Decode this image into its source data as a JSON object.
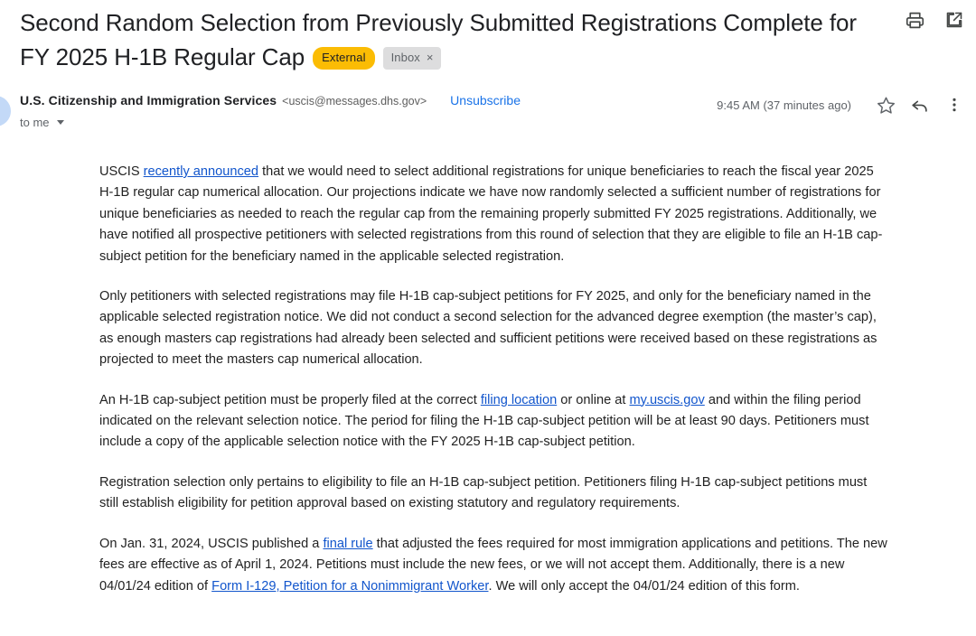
{
  "subject": {
    "text": "Second Random Selection from Previously Submitted Registrations Complete for FY 2025 H-1B Regular Cap",
    "external_badge": "External",
    "inbox_label": "Inbox",
    "inbox_close": "×"
  },
  "header_actions": [
    {
      "name": "print-icon",
      "title": "Print all"
    },
    {
      "name": "open-in-new-window-icon",
      "title": "In new window"
    }
  ],
  "sender": {
    "name": "U.S. Citizenship and Immigration Services",
    "email": "<uscis@messages.dhs.gov>",
    "unsubscribe": "Unsubscribe",
    "recipients": "to me",
    "timestamp": "9:45 AM (37 minutes ago)"
  },
  "message_actions": [
    {
      "name": "star-icon",
      "title": "Not starred"
    },
    {
      "name": "reply-icon",
      "title": "Reply"
    },
    {
      "name": "more-options-icon",
      "title": "More"
    }
  ],
  "body": {
    "p1_a": "USCIS ",
    "p1_link": "recently announced",
    "p1_b": " that we would need to select additional registrations for unique beneficiaries to reach the fiscal year 2025 H-1B regular cap numerical allocation. Our projections indicate we have now randomly selected a sufficient number of registrations for unique beneficiaries as needed to reach the regular cap from the remaining properly submitted FY 2025 registrations. Additionally, we have notified all prospective petitioners with selected registrations from this round of selection that they are eligible to file an H-1B cap-subject petition for the beneficiary named in the applicable selected registration.",
    "p2": "Only petitioners with selected registrations may file H-1B cap-subject petitions for FY 2025, and only for the beneficiary named in the applicable selected registration notice. We did not conduct a second selection for the advanced degree exemption (the master’s cap), as enough masters cap registrations had already been selected and sufficient petitions were received based on these registrations as projected to meet the masters cap numerical allocation.",
    "p3_a": "An H-1B cap-subject petition must be properly filed at the correct ",
    "p3_link1": "filing location",
    "p3_b": " or online at ",
    "p3_link2": "my.uscis.gov",
    "p3_c": " and within the filing period indicated on the relevant selection notice. The period for filing the H-1B cap-subject petition will be at least 90 days. Petitioners must include a copy of the applicable selection notice with the FY 2025 H-1B cap-subject petition.",
    "p4": "Registration selection only pertains to eligibility to file an H-1B cap-subject petition. Petitioners filing H-1B cap-subject petitions must still establish eligibility for petition approval based on existing statutory and regulatory requirements.",
    "p5_a": "On Jan. 31, 2024, USCIS published a ",
    "p5_link1": "final rule",
    "p5_b": " that adjusted the fees required for most immigration applications and petitions. The new fees are effective as of April 1, 2024. Petitions must include the new fees, or we will not accept them. Additionally, there is a new 04/01/24 edition of ",
    "p5_link2": "Form I-129, Petition for a Nonimmigrant Worker",
    "p5_c": ". We will only accept the 04/01/24 edition of this form."
  },
  "colors": {
    "external_badge_bg": "#fbbc04",
    "inbox_badge_bg": "#ddddde",
    "link_blue": "#1155cc",
    "action_blue": "#1a73e8",
    "text": "#202124",
    "muted_text": "#5f6368",
    "avatar_bg": "#c3d9f7"
  }
}
